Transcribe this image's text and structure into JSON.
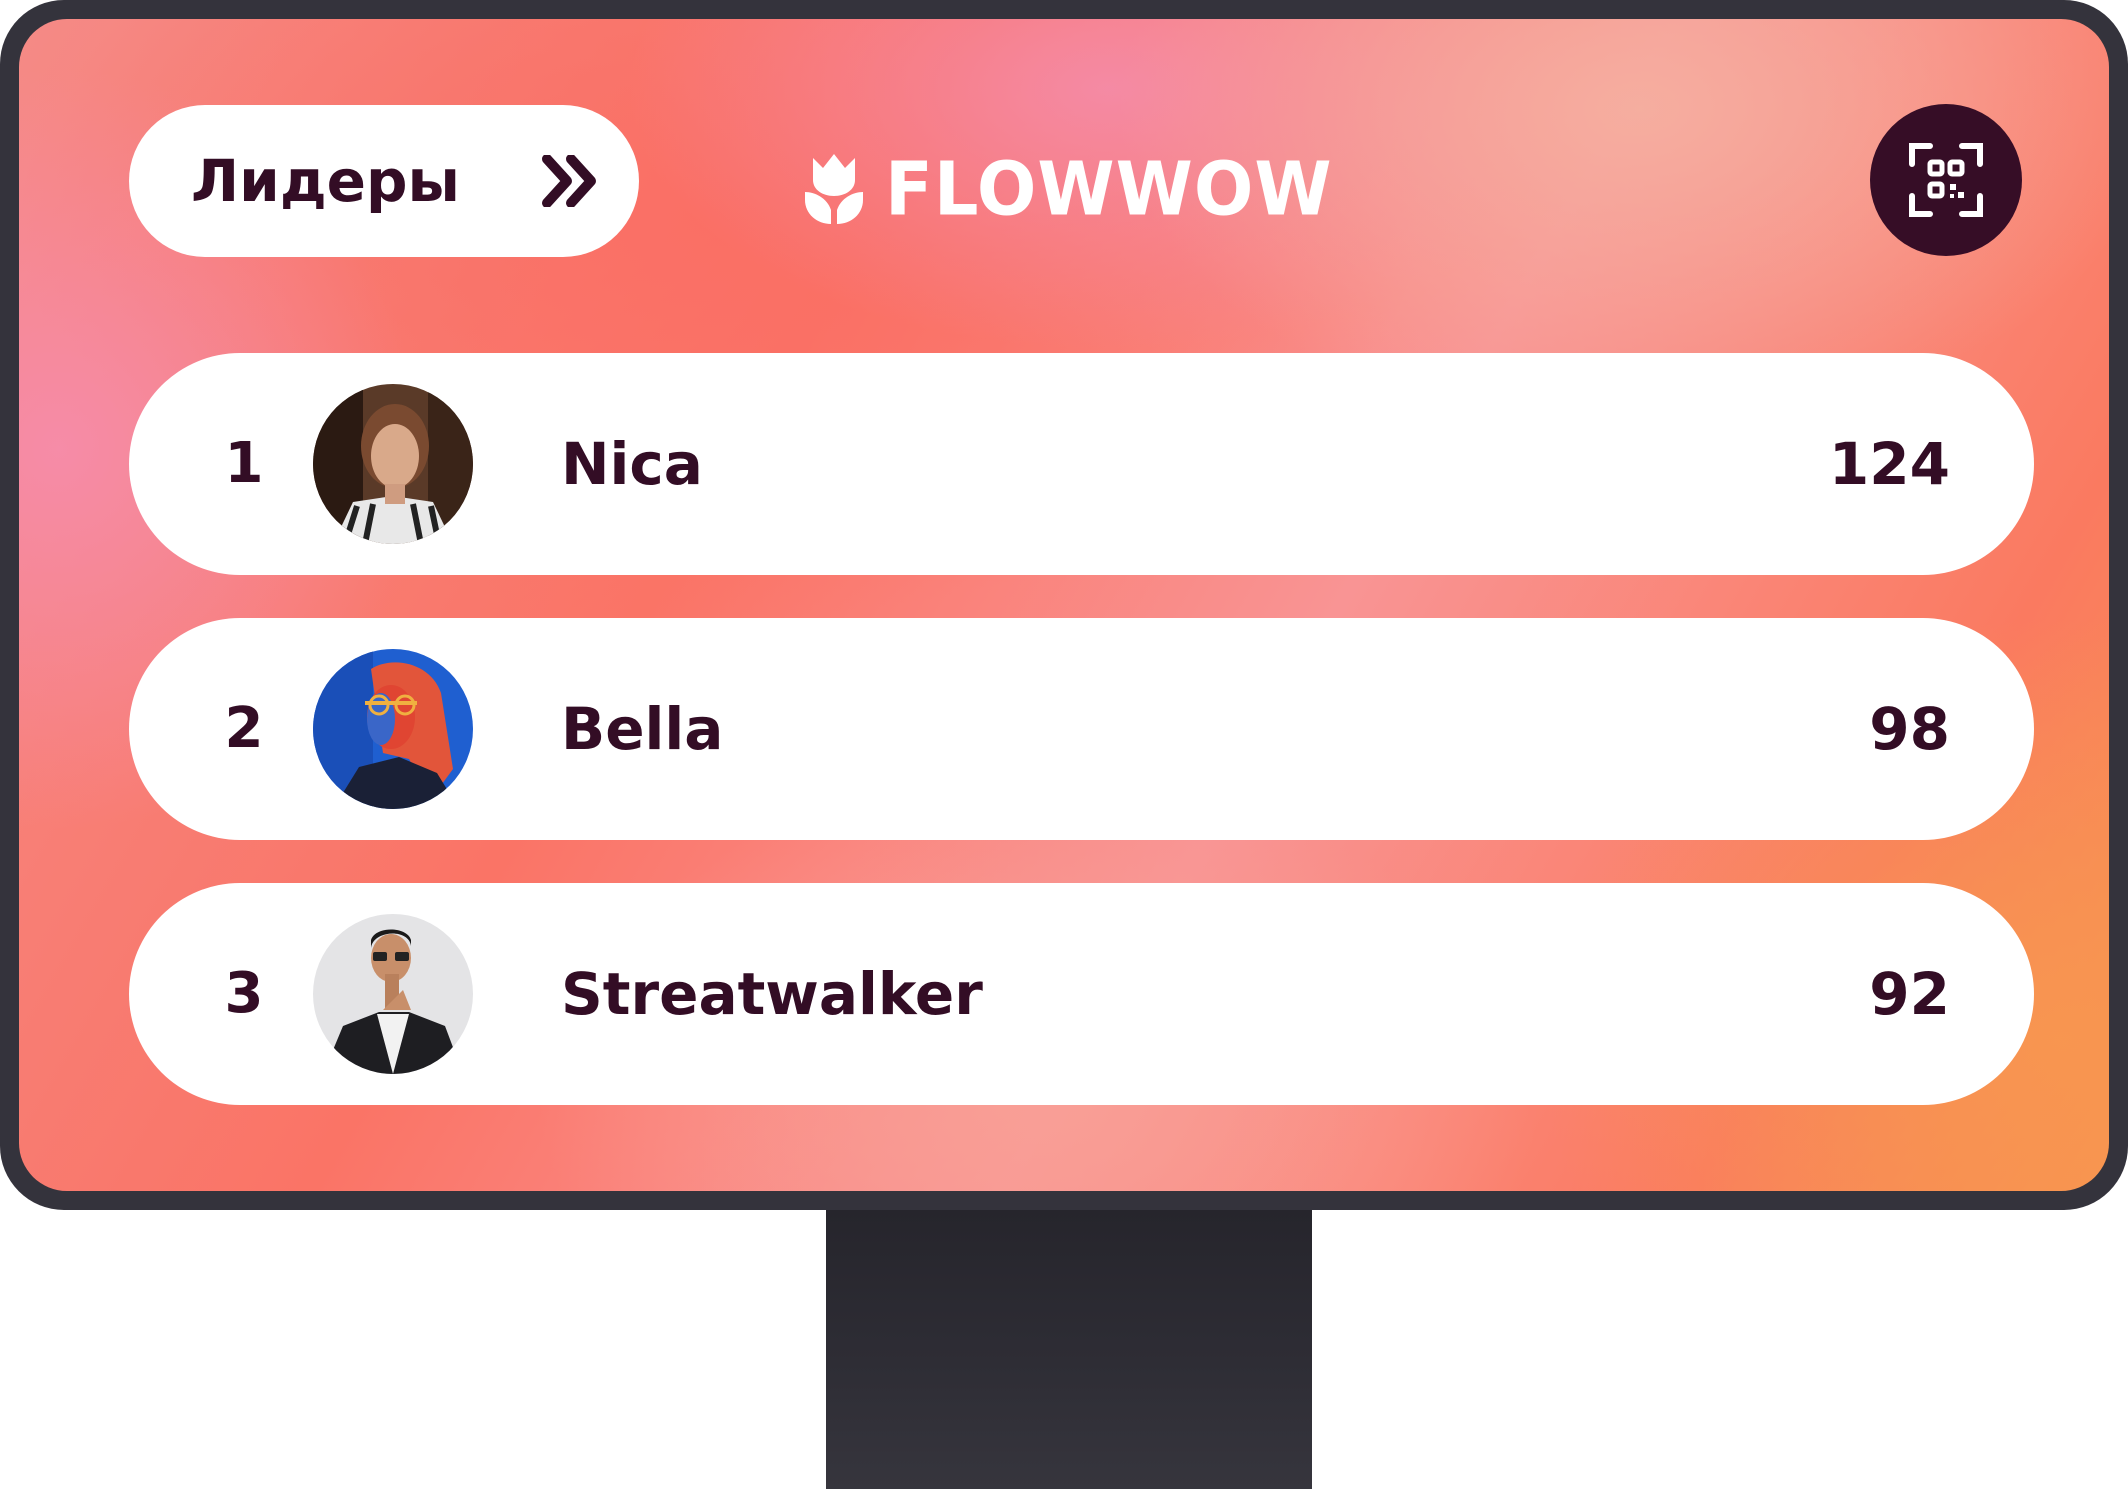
{
  "header": {
    "leaders_label": "Лидеры",
    "leaders_icon": "double-chevron-right-icon",
    "logo_text": "FLOWWOW",
    "logo_icon": "tulip-icon",
    "qr_icon": "qr-scan-icon"
  },
  "leaderboard": [
    {
      "rank": "1",
      "name": "Nica",
      "score": "124",
      "avatar": "avatar-photo-woman-dark-hair"
    },
    {
      "rank": "2",
      "name": "Bella",
      "score": "98",
      "avatar": "avatar-photo-woman-neon"
    },
    {
      "rank": "3",
      "name": "Streatwalker",
      "score": "92",
      "avatar": "avatar-photo-man-glasses"
    }
  ],
  "colors": {
    "text_dark": "#330d25",
    "qr_button_bg": "#360d26",
    "bezel": "#34333c",
    "background_gradient": [
      "#f58a86",
      "#fa7466",
      "#f99494",
      "#f7954f"
    ]
  }
}
